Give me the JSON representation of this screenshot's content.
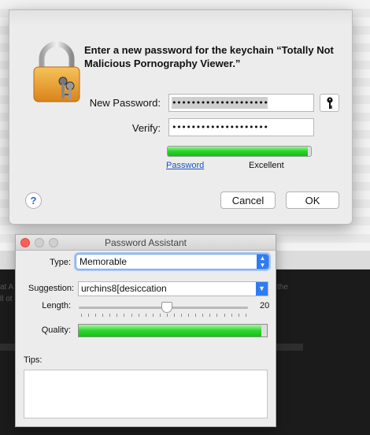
{
  "dialog": {
    "title": "Enter a new password for the keychain “Totally Not Malicious Pornography Viewer.”",
    "new_password_label": "New Password:",
    "new_password_value": "••••••••••••••••••••",
    "verify_label": "Verify:",
    "verify_value": "••••••••••••••••••••",
    "strength_link": "Password",
    "strength_value": "Excellent",
    "strength_level": 0.98,
    "help_label": "?",
    "cancel_label": "Cancel",
    "ok_label": "OK",
    "icons": {
      "lock": "padlock-keys-icon",
      "key": "key-icon"
    }
  },
  "assistant": {
    "title": "Password Assistant",
    "type_label": "Type:",
    "type_value": "Memorable",
    "suggestion_label": "Suggestion:",
    "suggestion_value": "urchins8[desiccation",
    "length_label": "Length:",
    "length_value": "20",
    "quality_label": "Quality:",
    "quality_level": 0.97,
    "tips_label": "Tips:",
    "tips_text": ""
  },
  "background": {
    "fragments": [
      "at A",
      "ll ot",
      "the"
    ]
  },
  "colors": {
    "accent": "#2f7bf2",
    "meter_green": "#29d329",
    "close": "#fc5f57",
    "inactive_light": "#c8c8c8"
  }
}
